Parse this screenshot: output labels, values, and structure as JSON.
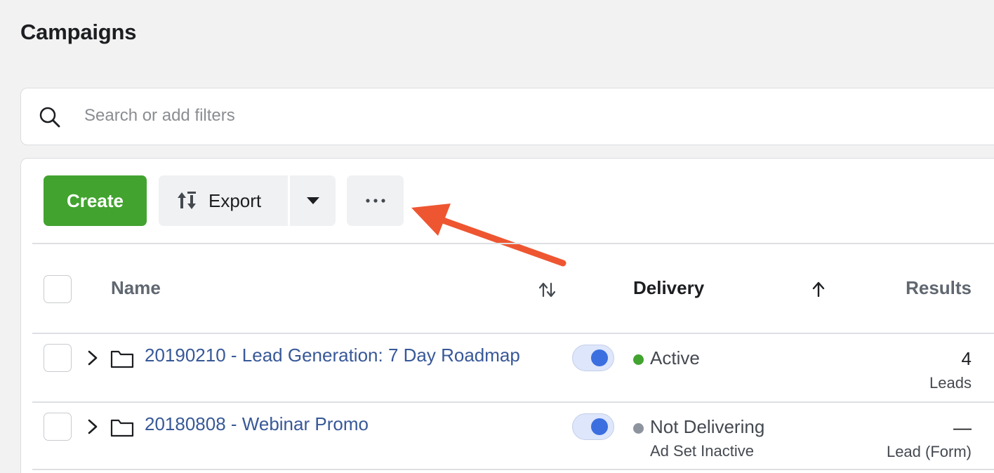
{
  "page": {
    "title": "Campaigns"
  },
  "search": {
    "placeholder": "Search or add filters",
    "value": ""
  },
  "toolbar": {
    "create_label": "Create",
    "export_label": "Export",
    "more_label": "···"
  },
  "table": {
    "headers": {
      "name": "Name",
      "delivery": "Delivery",
      "results": "Results"
    },
    "rows": [
      {
        "name": "20190210 - Lead Generation: 7 Day Roadmap",
        "toggle_on": true,
        "delivery": "Active",
        "delivery_sub": "",
        "delivery_color": "#42a32f",
        "result_value": "4",
        "result_label": "Leads"
      },
      {
        "name": "20180808 - Webinar Promo",
        "toggle_on": true,
        "delivery": "Not Delivering",
        "delivery_sub": "Ad Set Inactive",
        "delivery_color": "#8d949e",
        "result_value": "—",
        "result_label": "Lead (Form)"
      }
    ]
  },
  "colors": {
    "create_button": "#42a32f",
    "link": "#385898",
    "toggle_knob": "#3b6fe0",
    "annotation_arrow": "#ee5631"
  },
  "icons": {
    "search": "search-icon",
    "export": "export-icon",
    "dropdown": "caret-down-icon",
    "more": "more-horizontal-icon",
    "sort_both": "sort-up-down-icon",
    "sort_up": "sort-up-arrow-icon",
    "expand": "chevron-right-icon",
    "folder": "folder-icon"
  }
}
